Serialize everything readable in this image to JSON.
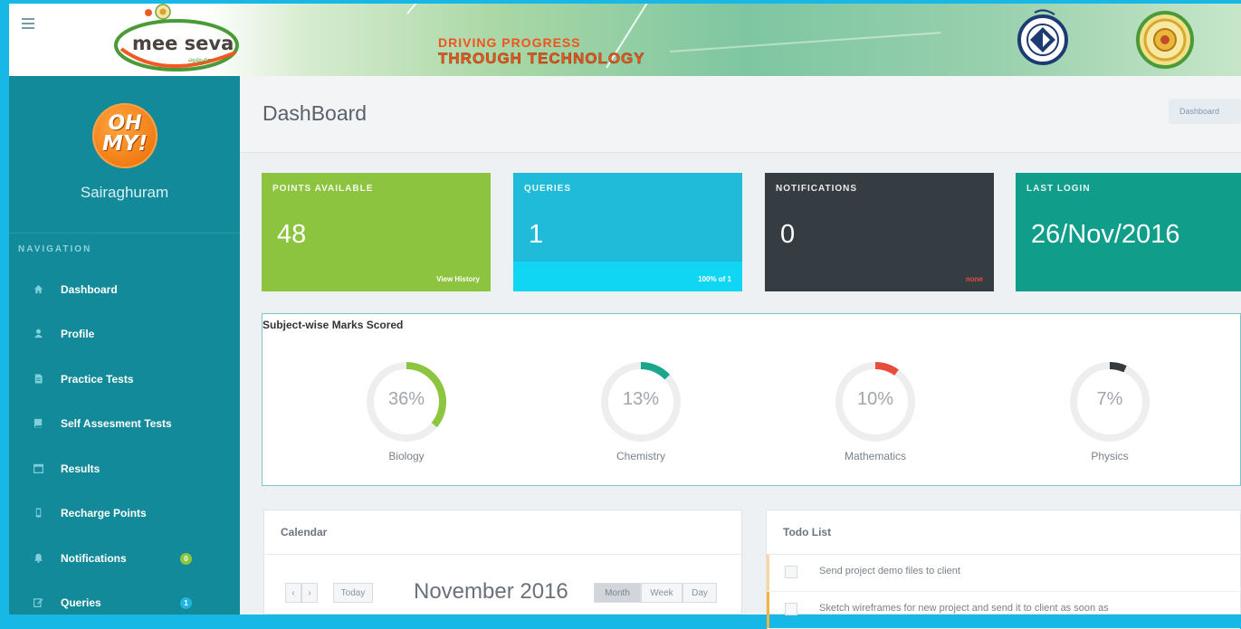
{
  "banner": {
    "logo_text": "mee seva",
    "logo_subtext": "ఎల్లప్పుడూ",
    "tagline_line1": "DRIVING PROGRESS",
    "tagline_line2": "THROUGH TECHNOLOGY",
    "menu_icon": "hamburger-icon"
  },
  "sidebar": {
    "avatar_text_top": "OH",
    "avatar_text_bottom": "MY!",
    "user_name": "Sairaghuram",
    "nav_heading": "NAVIGATION",
    "items": [
      {
        "label": "Dashboard",
        "icon": "home-icon",
        "badge": null
      },
      {
        "label": "Profile",
        "icon": "user-icon",
        "badge": null
      },
      {
        "label": "Practice Tests",
        "icon": "file-icon",
        "badge": null
      },
      {
        "label": "Self Assesment Tests",
        "icon": "book-icon",
        "badge": null
      },
      {
        "label": "Results",
        "icon": "calendar-icon",
        "badge": null
      },
      {
        "label": "Recharge Points",
        "icon": "mobile-icon",
        "badge": null
      },
      {
        "label": "Notifications",
        "icon": "bell-icon",
        "badge": "0"
      },
      {
        "label": "Queries",
        "icon": "edit-icon",
        "badge": "1"
      }
    ],
    "colors": {
      "background": "#138a99",
      "badge_green": "#8cc63f",
      "badge_blue": "#1fb5e0"
    }
  },
  "header": {
    "title": "DashBoard",
    "breadcrumb": "Dashboard"
  },
  "stats": [
    {
      "label": "POINTS AVAILABLE",
      "value": "48",
      "footer": "View History",
      "color": "#8cc43f",
      "footer_color": "#8cc43f"
    },
    {
      "label": "QUERIES",
      "value": "1",
      "footer": "100% of 1",
      "color": "#1fbbd8",
      "footer_color": "#11d6f3"
    },
    {
      "label": "NOTIFICATIONS",
      "value": "0",
      "footer": "none",
      "color": "#353c42",
      "footer_color": "#353c42"
    },
    {
      "label": "LAST LOGIN",
      "value": "26/Nov/2016",
      "footer": "",
      "color": "#109d8a",
      "footer_color": "#109d8a"
    }
  ],
  "marks": {
    "title": "Subject-wise Marks Scored",
    "subjects": [
      {
        "name": "Biology",
        "percent": 36,
        "label": "36%",
        "color": "#8cc63f"
      },
      {
        "name": "Chemistry",
        "percent": 13,
        "label": "13%",
        "color": "#1ba68d"
      },
      {
        "name": "Mathematics",
        "percent": 10,
        "label": "10%",
        "color": "#e84c3d"
      },
      {
        "name": "Physics",
        "percent": 7,
        "label": "7%",
        "color": "#343a40"
      }
    ]
  },
  "calendar": {
    "title": "Calendar",
    "prev": "‹",
    "next": "›",
    "today": "Today",
    "month": "November 2016",
    "views": [
      "Month",
      "Week",
      "Day"
    ],
    "active_view": "Month"
  },
  "todo": {
    "title": "Todo List",
    "items": [
      {
        "text": "Send project demo files to client",
        "accent": "#f9d5a0"
      },
      {
        "text": "Sketch wireframes for new project and send it to client as soon as",
        "accent": "#f7b43c"
      }
    ]
  }
}
